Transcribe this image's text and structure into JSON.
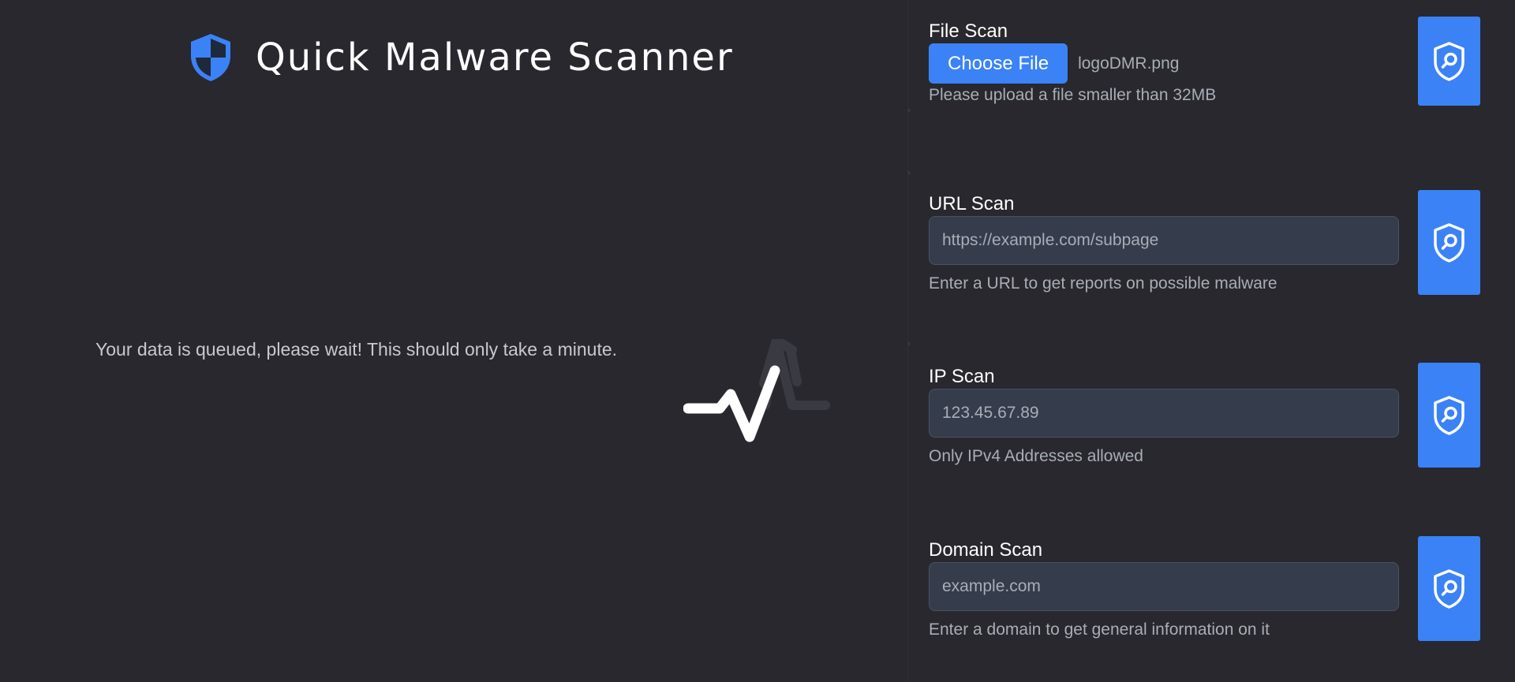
{
  "app": {
    "title": "Quick Malware Scanner",
    "logo_icon": "shield-icon",
    "accent_color": "#3b82f6"
  },
  "status": {
    "message": "Your data is queued, please wait! This should only take a minute.",
    "loader_icon": "pulse-loader-icon"
  },
  "file_scan": {
    "label": "File Scan",
    "choose_button_label": "Choose File",
    "selected_file": "logoDMR.png",
    "help_text": "Please upload a file smaller than 32MB",
    "submit_icon": "shield-search-icon"
  },
  "url_scan": {
    "label": "URL Scan",
    "placeholder": "https://example.com/subpage",
    "value": "",
    "help_text": "Enter a URL to get reports on possible malware",
    "submit_icon": "shield-search-icon"
  },
  "ip_scan": {
    "label": "IP Scan",
    "placeholder": "123.45.67.89",
    "value": "",
    "help_text": "Only IPv4 Addresses allowed",
    "submit_icon": "shield-search-icon"
  },
  "domain_scan": {
    "label": "Domain Scan",
    "placeholder": "example.com",
    "value": "",
    "help_text": "Enter a domain to get general information on it",
    "submit_icon": "shield-search-icon"
  }
}
